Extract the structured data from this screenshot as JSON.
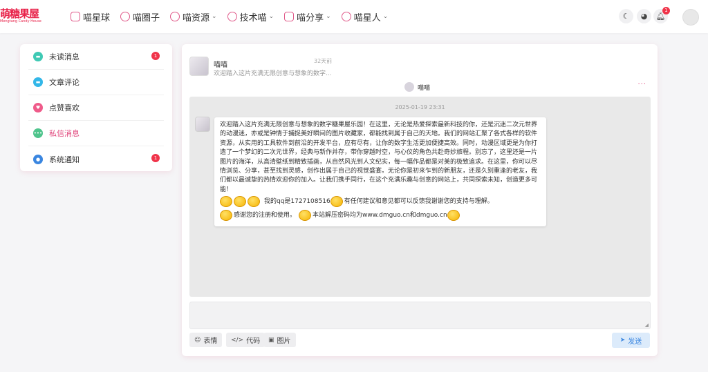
{
  "logo": {
    "main": "萌糖果屋",
    "sub": "Mengtang Candy House"
  },
  "nav": [
    {
      "label": "喵星球",
      "icon": "cat-face-icon",
      "dropdown": false
    },
    {
      "label": "喵圈子",
      "icon": "chat-bubble-icon",
      "dropdown": false
    },
    {
      "label": "喵资源",
      "icon": "at-sign-icon",
      "dropdown": true
    },
    {
      "label": "技术喵",
      "icon": "speech-icon",
      "dropdown": true
    },
    {
      "label": "喵分享",
      "icon": "document-icon",
      "dropdown": true
    },
    {
      "label": "喵星人",
      "icon": "badge-icon",
      "dropdown": true
    }
  ],
  "header_right": {
    "notification_count": "1"
  },
  "sidebar": [
    {
      "label": "未读消息",
      "icon": "unread-message-icon",
      "color": "#3fc9b4",
      "badge": "1"
    },
    {
      "label": "文章评论",
      "icon": "comment-icon",
      "color": "#33b7e8",
      "badge": ""
    },
    {
      "label": "点赞喜欢",
      "icon": "heart-icon",
      "color": "#ef5b8a",
      "badge": ""
    },
    {
      "label": "私信消息",
      "icon": "private-message-icon",
      "color": "#4fc48c",
      "badge": "",
      "active": true
    },
    {
      "label": "系统通知",
      "icon": "notification-icon",
      "color": "#3a86e0",
      "badge": "1"
    }
  ],
  "conversation": {
    "name": "喵喵",
    "time": "32天前",
    "preview": "欢迎踏入这片充满无限创意与想象的数字..."
  },
  "chat": {
    "user": "喵喵",
    "timestamp": "2025-01-19 23:31",
    "message": "欢迎踏入这片充满无限创意与想象的数字糖果屋乐园！在这里，无论是热爱探索最新科技的你，还是沉迷二次元世界的动漫迷，亦或是钟情于捕捉美好瞬间的图片收藏家，都能找到属于自己的天地。我们的网站汇聚了各式各样的软件资源，从实用的工具软件到前沿的开发平台，应有尽有，让你的数字生活更加便捷高效。同时，动漫区域更是为你打造了一个梦幻的二次元世界，经典与新作并存，带你穿越时空，与心仪的角色共赴奇妙旅程。别忘了，这里还是一片图片的海洋，从高清壁纸到精致插画，从自然风光到人文纪实，每一幅作品都是对美的极致追求。在这里，你可以尽情浏览、分享，甚至找到灵感，创作出属于自己的视觉盛宴。无论你是初来乍到的新朋友，还是久别重逢的老友，我们都以最诚挚的热情欢迎你的加入。让我们携手同行，在这个充满乐趣与创意的网站上，共同探索未知，创造更多可能！",
    "qq_line": "我的qq是1727108516",
    "qq_suffix": "有任何建议和意见都可以反馈我谢谢您的支持与理解。",
    "thanks": "感谢您的注册和使用。",
    "password_line": "本站解压密码均为www.dmguo.cn和dmguo.cn"
  },
  "toolbar": {
    "emoji": "表情",
    "code": "代码",
    "image": "图片",
    "send": "发送"
  }
}
